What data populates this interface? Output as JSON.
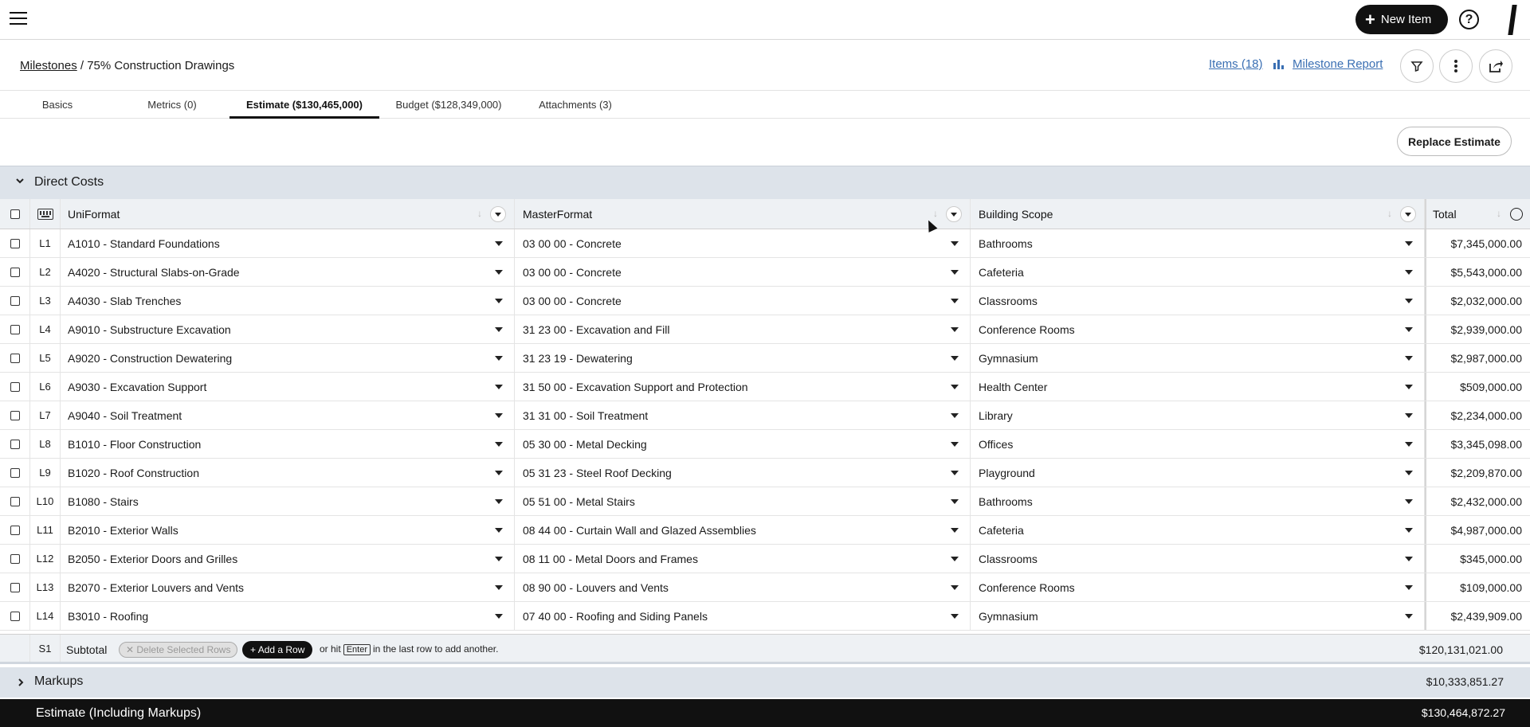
{
  "topbar": {
    "new_item_label": "New Item",
    "help_icon": "question-circle-icon"
  },
  "breadcrumb": {
    "root": "Milestones",
    "separator": "/",
    "current": "75% Construction Drawings"
  },
  "header_links": {
    "items": "Items (18)",
    "report": "Milestone Report"
  },
  "tabs": [
    {
      "label": "Basics"
    },
    {
      "label": "Metrics (0)"
    },
    {
      "label": "Estimate ($130,465,000)"
    },
    {
      "label": "Budget ($128,349,000)"
    },
    {
      "label": "Attachments (3)"
    }
  ],
  "replace_estimate_label": "Replace Estimate",
  "direct_costs": {
    "title": "Direct Costs",
    "columns": {
      "uniformat": "UniFormat",
      "masterformat": "MasterFormat",
      "building_scope": "Building Scope",
      "total": "Total"
    },
    "rows": [
      {
        "id": "L1",
        "uni": "A1010 - Standard Foundations",
        "master": "03 00 00 - Concrete",
        "scope": "Bathrooms",
        "total": "$7,345,000.00"
      },
      {
        "id": "L2",
        "uni": "A4020 - Structural Slabs-on-Grade",
        "master": "03 00 00 - Concrete",
        "scope": "Cafeteria",
        "total": "$5,543,000.00"
      },
      {
        "id": "L3",
        "uni": "A4030 - Slab Trenches",
        "master": "03 00 00 - Concrete",
        "scope": "Classrooms",
        "total": "$2,032,000.00"
      },
      {
        "id": "L4",
        "uni": "A9010 - Substructure Excavation",
        "master": "31 23 00 - Excavation and Fill",
        "scope": "Conference Rooms",
        "total": "$2,939,000.00"
      },
      {
        "id": "L5",
        "uni": "A9020 - Construction Dewatering",
        "master": "31 23 19 - Dewatering",
        "scope": "Gymnasium",
        "total": "$2,987,000.00"
      },
      {
        "id": "L6",
        "uni": "A9030 - Excavation Support",
        "master": "31 50 00 - Excavation Support and Protection",
        "scope": "Health Center",
        "total": "$509,000.00"
      },
      {
        "id": "L7",
        "uni": "A9040 - Soil Treatment",
        "master": "31 31 00 - Soil Treatment",
        "scope": "Library",
        "total": "$2,234,000.00"
      },
      {
        "id": "L8",
        "uni": "B1010 - Floor Construction",
        "master": "05 30 00 - Metal Decking",
        "scope": "Offices",
        "total": "$3,345,098.00"
      },
      {
        "id": "L9",
        "uni": "B1020 - Roof Construction",
        "master": "05 31 23 - Steel Roof Decking",
        "scope": "Playground",
        "total": "$2,209,870.00"
      },
      {
        "id": "L10",
        "uni": "B1080 - Stairs",
        "master": "05 51 00 - Metal Stairs",
        "scope": "Bathrooms",
        "total": "$2,432,000.00"
      },
      {
        "id": "L11",
        "uni": "B2010 - Exterior Walls",
        "master": "08 44 00 - Curtain Wall and Glazed Assemblies",
        "scope": "Cafeteria",
        "total": "$4,987,000.00"
      },
      {
        "id": "L12",
        "uni": "B2050 - Exterior Doors and Grilles",
        "master": "08 11 00 - Metal Doors and Frames",
        "scope": "Classrooms",
        "total": "$345,000.00"
      },
      {
        "id": "L13",
        "uni": "B2070 - Exterior Louvers and Vents",
        "master": "08 90 00 - Louvers and Vents",
        "scope": "Conference Rooms",
        "total": "$109,000.00"
      },
      {
        "id": "L14",
        "uni": "B3010 - Roofing",
        "master": "07 40 00 - Roofing and Siding Panels",
        "scope": "Gymnasium",
        "total": "$2,439,909.00"
      }
    ],
    "subtotal": {
      "id": "S1",
      "label": "Subtotal",
      "delete_label": "Delete Selected Rows",
      "add_label": "Add a Row",
      "hint_before": "or hit",
      "hint_key": "Enter",
      "hint_after": "in the last row to add another.",
      "value": "$120,131,021.00"
    }
  },
  "markups": {
    "title": "Markups",
    "value": "$10,333,851.27"
  },
  "footer": {
    "label": "Estimate (Including Markups)",
    "value": "$130,464,872.27"
  }
}
